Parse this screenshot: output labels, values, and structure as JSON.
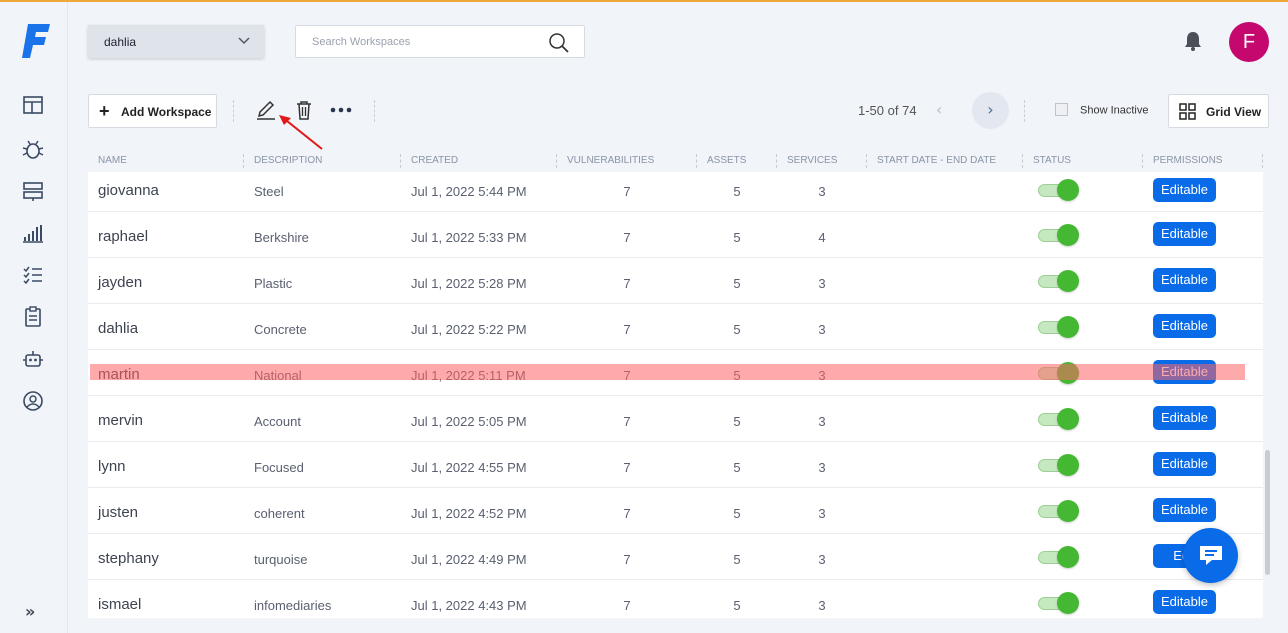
{
  "header": {
    "workspace_selected": "dahlia",
    "search_placeholder": "Search Workspaces",
    "avatar_initial": "F"
  },
  "toolbar": {
    "add_label": "Add Workspace",
    "pager_text": "1-50 of 74",
    "prev": "‹",
    "next": "›",
    "show_inactive_label": "Show Inactive",
    "grid_view_label": "Grid View"
  },
  "sidebar": {
    "expand": "»",
    "icons": [
      "dashboard-icon",
      "bug-icon",
      "server-icon",
      "analytics-icon",
      "checklist-icon",
      "clipboard-icon",
      "robot-icon",
      "user-circle-icon"
    ]
  },
  "table": {
    "columns": [
      "NAME",
      "DESCRIPTION",
      "CREATED",
      "VULNERABILITIES",
      "ASSETS",
      "SERVICES",
      "START DATE - END DATE",
      "STATUS",
      "PERMISSIONS"
    ],
    "rows": [
      {
        "name": "giovanna",
        "description": "Steel",
        "created": "Jul 1, 2022 5:44 PM",
        "vulnerabilities": "7",
        "assets": "5",
        "services": "3",
        "dates": "",
        "permission": "Editable"
      },
      {
        "name": "raphael",
        "description": "Berkshire",
        "created": "Jul 1, 2022 5:33 PM",
        "vulnerabilities": "7",
        "assets": "5",
        "services": "4",
        "dates": "",
        "permission": "Editable"
      },
      {
        "name": "jayden",
        "description": "Plastic",
        "created": "Jul 1, 2022 5:28 PM",
        "vulnerabilities": "7",
        "assets": "5",
        "services": "3",
        "dates": "",
        "permission": "Editable"
      },
      {
        "name": "dahlia",
        "description": "Concrete",
        "created": "Jul 1, 2022 5:22 PM",
        "vulnerabilities": "7",
        "assets": "5",
        "services": "3",
        "dates": "",
        "permission": "Editable"
      },
      {
        "name": "martin",
        "description": "National",
        "created": "Jul 1, 2022 5:11 PM",
        "vulnerabilities": "7",
        "assets": "5",
        "services": "3",
        "dates": "",
        "permission": "Editable"
      },
      {
        "name": "mervin",
        "description": "Account",
        "created": "Jul 1, 2022 5:05 PM",
        "vulnerabilities": "7",
        "assets": "5",
        "services": "3",
        "dates": "",
        "permission": "Editable"
      },
      {
        "name": "lynn",
        "description": "Focused",
        "created": "Jul 1, 2022 4:55 PM",
        "vulnerabilities": "7",
        "assets": "5",
        "services": "3",
        "dates": "",
        "permission": "Editable"
      },
      {
        "name": "justen",
        "description": "coherent",
        "created": "Jul 1, 2022 4:52 PM",
        "vulnerabilities": "7",
        "assets": "5",
        "services": "3",
        "dates": "",
        "permission": "Editable"
      },
      {
        "name": "stephany",
        "description": "turquoise",
        "created": "Jul 1, 2022 4:49 PM",
        "vulnerabilities": "7",
        "assets": "5",
        "services": "3",
        "dates": "",
        "permission": "Edit"
      },
      {
        "name": "ismael",
        "description": "infomediaries",
        "created": "Jul 1, 2022 4:43 PM",
        "vulnerabilities": "7",
        "assets": "5",
        "services": "3",
        "dates": "",
        "permission": "Editable"
      }
    ],
    "highlighted_row": "martin"
  },
  "colors": {
    "brand_blue": "#0a6be8",
    "toggle_green": "#44b832",
    "avatar_bg": "#c4086e",
    "highlight_red": "#ff6464",
    "annotation_arrow": "#e01818"
  }
}
